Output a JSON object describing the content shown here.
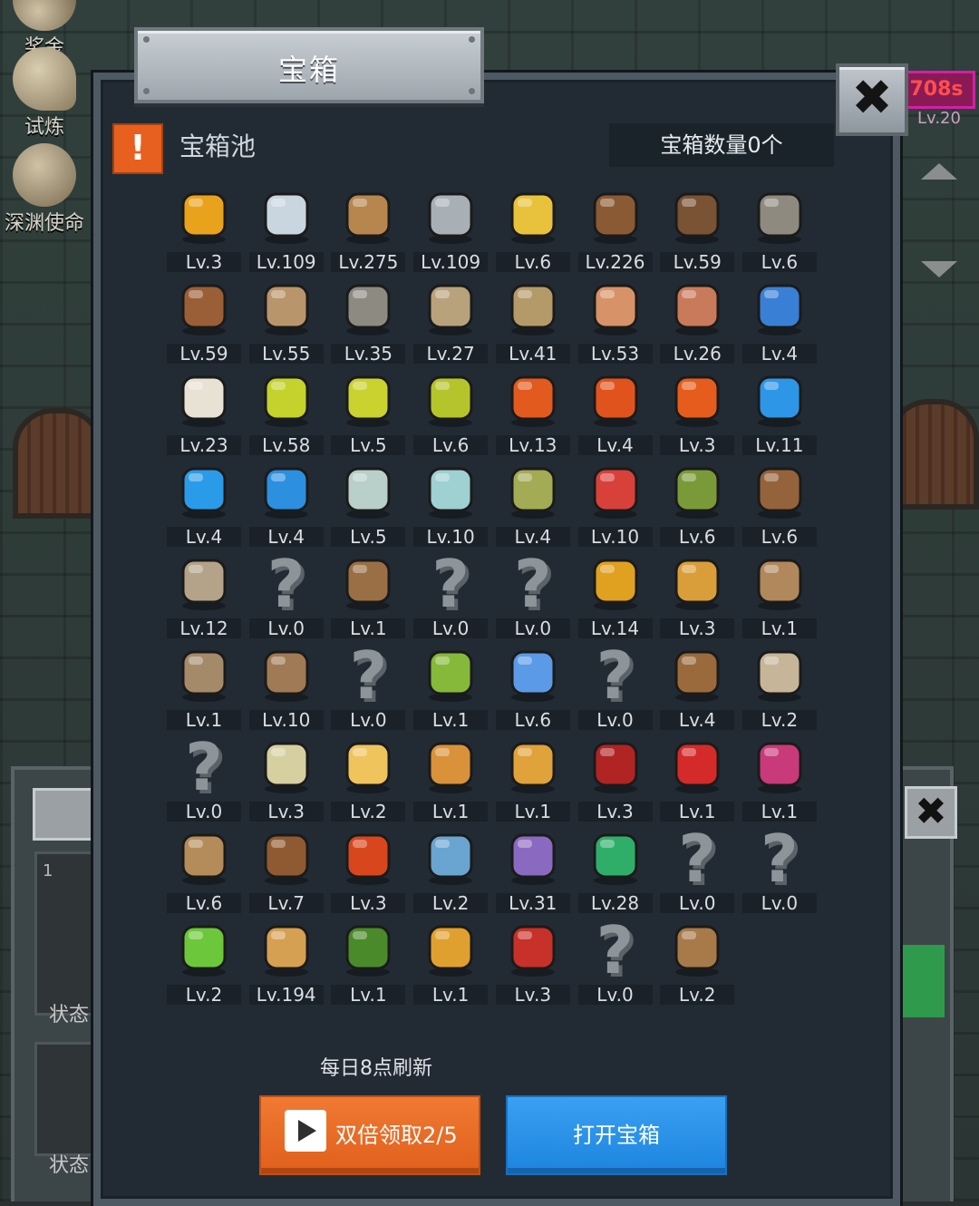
{
  "side_nav": {
    "items": [
      {
        "label": "奖金"
      },
      {
        "label": "试炼"
      },
      {
        "label": "深渊使命"
      }
    ]
  },
  "right_hud": {
    "timer_badge": "708s",
    "level_text": "Lv.20"
  },
  "underlying": {
    "status_label_1": "状态",
    "status_label_2": "状态",
    "slot_number": "1",
    "right_value": "0"
  },
  "modal": {
    "title": "宝箱",
    "close_label": "✖",
    "pool_title": "宝箱池",
    "warn_mark": "!",
    "chest_count": "宝箱数量0个",
    "refresh_note": "每日8点刷新",
    "double_button": "双倍领取2/5",
    "open_button": "打开宝箱"
  },
  "items": [
    {
      "icon": "crown-icon",
      "level": "Lv.3"
    },
    {
      "icon": "diamond-icon",
      "level": "Lv.109"
    },
    {
      "icon": "wooden-sword-icon",
      "level": "Lv.275"
    },
    {
      "icon": "iron-sword-icon",
      "level": "Lv.109"
    },
    {
      "icon": "gold-sword-icon",
      "level": "Lv.6"
    },
    {
      "icon": "leather-armor-icon",
      "level": "Lv.226"
    },
    {
      "icon": "leather-vest-icon",
      "level": "Lv.59"
    },
    {
      "icon": "iron-armor-icon",
      "level": "Lv.6"
    },
    {
      "icon": "leather-helmet-icon",
      "level": "Lv.59"
    },
    {
      "icon": "dagger-icon",
      "level": "Lv.55"
    },
    {
      "icon": "knight-helmet-icon",
      "level": "Lv.35"
    },
    {
      "icon": "hammer-icon",
      "level": "Lv.27"
    },
    {
      "icon": "great-helm-icon",
      "level": "Lv.41"
    },
    {
      "icon": "ham-icon",
      "level": "Lv.53"
    },
    {
      "icon": "steak-icon",
      "level": "Lv.26"
    },
    {
      "icon": "pouch-icon",
      "level": "Lv.4"
    },
    {
      "icon": "flour-bowl-icon",
      "level": "Lv.23"
    },
    {
      "icon": "yellow-potion-icon",
      "level": "Lv.58"
    },
    {
      "icon": "yellow-flask-icon",
      "level": "Lv.5"
    },
    {
      "icon": "yellow-round-potion-icon",
      "level": "Lv.6"
    },
    {
      "icon": "red-potion-icon",
      "level": "Lv.13"
    },
    {
      "icon": "red-flask-icon",
      "level": "Lv.4"
    },
    {
      "icon": "red-round-potion-icon",
      "level": "Lv.3"
    },
    {
      "icon": "blue-potion-icon",
      "level": "Lv.11"
    },
    {
      "icon": "blue-flask-icon",
      "level": "Lv.4"
    },
    {
      "icon": "blue-round-potion-icon",
      "level": "Lv.4"
    },
    {
      "icon": "white-bottle-icon",
      "level": "Lv.5"
    },
    {
      "icon": "cyan-bottle-icon",
      "level": "Lv.10"
    },
    {
      "icon": "green-bottle-icon",
      "level": "Lv.4"
    },
    {
      "icon": "red-bottle-icon",
      "level": "Lv.10"
    },
    {
      "icon": "winged-boot-icon",
      "level": "Lv.6"
    },
    {
      "icon": "leather-boot-icon",
      "level": "Lv.6"
    },
    {
      "icon": "stone-boot-icon",
      "level": "Lv.12"
    },
    {
      "icon": "unknown-icon",
      "level": "Lv.0"
    },
    {
      "icon": "wooden-stick-icon",
      "level": "Lv.1"
    },
    {
      "icon": "unknown-icon",
      "level": "Lv.0"
    },
    {
      "icon": "unknown-icon",
      "level": "Lv.0"
    },
    {
      "icon": "torch-icon",
      "level": "Lv.14"
    },
    {
      "icon": "fire-staff-icon",
      "level": "Lv.3"
    },
    {
      "icon": "mushroom-icon",
      "level": "Lv.1"
    },
    {
      "icon": "pickaxe-icon",
      "level": "Lv.1"
    },
    {
      "icon": "crook-staff-icon",
      "level": "Lv.10"
    },
    {
      "icon": "unknown-icon",
      "level": "Lv.0"
    },
    {
      "icon": "lime-icon",
      "level": "Lv.1"
    },
    {
      "icon": "blue-wand-icon",
      "level": "Lv.6"
    },
    {
      "icon": "unknown-icon",
      "level": "Lv.0"
    },
    {
      "icon": "backpack-icon",
      "level": "Lv.4"
    },
    {
      "icon": "shovel-icon",
      "level": "Lv.2"
    },
    {
      "icon": "unknown-icon",
      "level": "Lv.0"
    },
    {
      "icon": "bone-club-icon",
      "level": "Lv.3"
    },
    {
      "icon": "cheese-icon",
      "level": "Lv.2"
    },
    {
      "icon": "pie-icon",
      "level": "Lv.1"
    },
    {
      "icon": "honey-jar-icon",
      "level": "Lv.1"
    },
    {
      "icon": "red-crystal-icon",
      "level": "Lv.3"
    },
    {
      "icon": "red-orb-icon",
      "level": "Lv.1"
    },
    {
      "icon": "magic-cube-icon",
      "level": "Lv.1"
    },
    {
      "icon": "bow-icon",
      "level": "Lv.6"
    },
    {
      "icon": "quiver-icon",
      "level": "Lv.7"
    },
    {
      "icon": "fire-charm-icon",
      "level": "Lv.3"
    },
    {
      "icon": "ice-charm-icon",
      "level": "Lv.2"
    },
    {
      "icon": "octo-charm-icon",
      "level": "Lv.31"
    },
    {
      "icon": "emerald-amulet-icon",
      "level": "Lv.28"
    },
    {
      "icon": "unknown-icon",
      "level": "Lv.0"
    },
    {
      "icon": "unknown-icon",
      "level": "Lv.0"
    },
    {
      "icon": "green-wand-icon",
      "level": "Lv.2"
    },
    {
      "icon": "beer-mug-icon",
      "level": "Lv.194"
    },
    {
      "icon": "vine-icon",
      "level": "Lv.1"
    },
    {
      "icon": "gold-pickaxe-icon",
      "level": "Lv.1"
    },
    {
      "icon": "spell-book-icon",
      "level": "Lv.3"
    },
    {
      "icon": "unknown-icon",
      "level": "Lv.0"
    },
    {
      "icon": "fishing-rod-icon",
      "level": "Lv.2"
    }
  ],
  "icon_colors": {
    "crown-icon": "#e9a21c",
    "diamond-icon": "#c9d6e0",
    "wooden-sword-icon": "#b7864f",
    "iron-sword-icon": "#a9b0b5",
    "gold-sword-icon": "#e8c23a",
    "leather-armor-icon": "#8a5a34",
    "leather-vest-icon": "#7a5234",
    "iron-armor-icon": "#8f8a80",
    "leather-helmet-icon": "#9a5f36",
    "dagger-icon": "#b8956a",
    "knight-helmet-icon": "#8d8a82",
    "hammer-icon": "#b8a27c",
    "great-helm-icon": "#b49a68",
    "ham-icon": "#d79367",
    "steak-icon": "#c97a5b",
    "pouch-icon": "#3a7fd6",
    "flour-bowl-icon": "#e8e2d5",
    "yellow-potion-icon": "#c5d22c",
    "yellow-flask-icon": "#c9d22f",
    "yellow-round-potion-icon": "#b6c42b",
    "red-potion-icon": "#e25a1e",
    "red-flask-icon": "#e0531c",
    "red-round-potion-icon": "#e65c1c",
    "blue-potion-icon": "#2d96e6",
    "blue-flask-icon": "#2a9be8",
    "blue-round-potion-icon": "#2c8fe0",
    "white-bottle-icon": "#b9cfc9",
    "cyan-bottle-icon": "#9fd0d2",
    "green-bottle-icon": "#a3ab54",
    "red-bottle-icon": "#d8403a",
    "winged-boot-icon": "#7a9a3a",
    "leather-boot-icon": "#94633b",
    "stone-boot-icon": "#b4a389",
    "unknown-icon": "#8d959b",
    "wooden-stick-icon": "#9a6f45",
    "torch-icon": "#e0a020",
    "fire-staff-icon": "#d99e3a",
    "mushroom-icon": "#b1875c",
    "pickaxe-icon": "#a58a6a",
    "crook-staff-icon": "#a07a54",
    "lime-icon": "#86b93a",
    "blue-wand-icon": "#5a9ae6",
    "backpack-icon": "#9a6a3c",
    "shovel-icon": "#c7b59a",
    "bone-club-icon": "#d6cfa0",
    "cheese-icon": "#f0c45c",
    "pie-icon": "#d9923a",
    "honey-jar-icon": "#e0a23a",
    "red-crystal-icon": "#b02424",
    "red-orb-icon": "#d42a2a",
    "magic-cube-icon": "#c83a7a",
    "bow-icon": "#b48c5a",
    "quiver-icon": "#8f5a32",
    "fire-charm-icon": "#d8461e",
    "ice-charm-icon": "#6aa4d0",
    "octo-charm-icon": "#8a6ac0",
    "emerald-amulet-icon": "#2fae6a",
    "green-wand-icon": "#6cc83a",
    "beer-mug-icon": "#d6a052",
    "vine-icon": "#4a8a2a",
    "gold-pickaxe-icon": "#e0a030",
    "spell-book-icon": "#c8302a",
    "fishing-rod-icon": "#a87a4a"
  }
}
